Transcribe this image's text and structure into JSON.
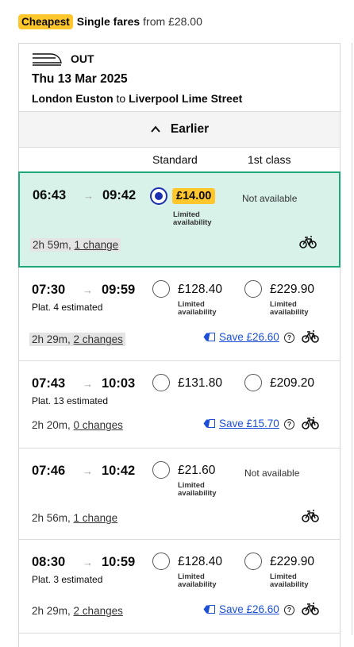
{
  "header": {
    "badge": "Cheapest",
    "fare_type": "Single fares",
    "from_price": "from £28.00"
  },
  "journey": {
    "direction": "OUT",
    "date": "Thu 13 Mar 2025",
    "origin": "London Euston",
    "to": "to",
    "destination": "Liverpool Lime Street"
  },
  "earlier_label": "Earlier",
  "columns": {
    "standard": "Standard",
    "first": "1st class"
  },
  "services": [
    {
      "depart": "06:43",
      "arrive": "09:42",
      "platform": "",
      "std_price": "£14.00",
      "std_limited": "Limited availability",
      "first_price": "",
      "first_limited": "",
      "first_unavailable": "Not available",
      "duration": "2h 59m,",
      "changes": "1 change",
      "save": "",
      "selected": true
    },
    {
      "depart": "07:30",
      "arrive": "09:59",
      "platform": "Plat. 4 estimated",
      "std_price": "£128.40",
      "std_limited": "Limited availability",
      "first_price": "£229.90",
      "first_limited": "Limited availability",
      "first_unavailable": "",
      "duration": "2h 29m,",
      "changes": "2 changes",
      "save": "Save £26.60",
      "selected": false
    },
    {
      "depart": "07:43",
      "arrive": "10:03",
      "platform": "Plat. 13 estimated",
      "std_price": "£131.80",
      "std_limited": "",
      "first_price": "£209.20",
      "first_limited": "",
      "first_unavailable": "",
      "duration": "2h 20m,",
      "changes": "0 changes",
      "save": "Save £15.70",
      "selected": false
    },
    {
      "depart": "07:46",
      "arrive": "10:42",
      "platform": "",
      "std_price": "£21.60",
      "std_limited": "Limited availability",
      "first_price": "",
      "first_limited": "",
      "first_unavailable": "Not available",
      "duration": "2h 56m,",
      "changes": "1 change",
      "save": "",
      "selected": false
    },
    {
      "depart": "08:30",
      "arrive": "10:59",
      "platform": "Plat. 3 estimated",
      "std_price": "£128.40",
      "std_limited": "Limited availability",
      "first_price": "£229.90",
      "first_limited": "Limited availability",
      "first_unavailable": "",
      "duration": "2h 29m,",
      "changes": "2 changes",
      "save": "Save £26.60",
      "selected": false
    }
  ],
  "colors": {
    "accent_yellow": "#ffc72c",
    "selected_bg": "#d8f2ea",
    "selected_border": "#1ea87a",
    "radio_blue": "#1b2fb0",
    "link_blue": "#1b4fd6"
  },
  "icons": {
    "train": "train-icon",
    "earlier": "chevron-up-icon",
    "bike": "bicycle-icon",
    "discount": "railcard-tag-icon",
    "help": "help-circle-icon"
  }
}
